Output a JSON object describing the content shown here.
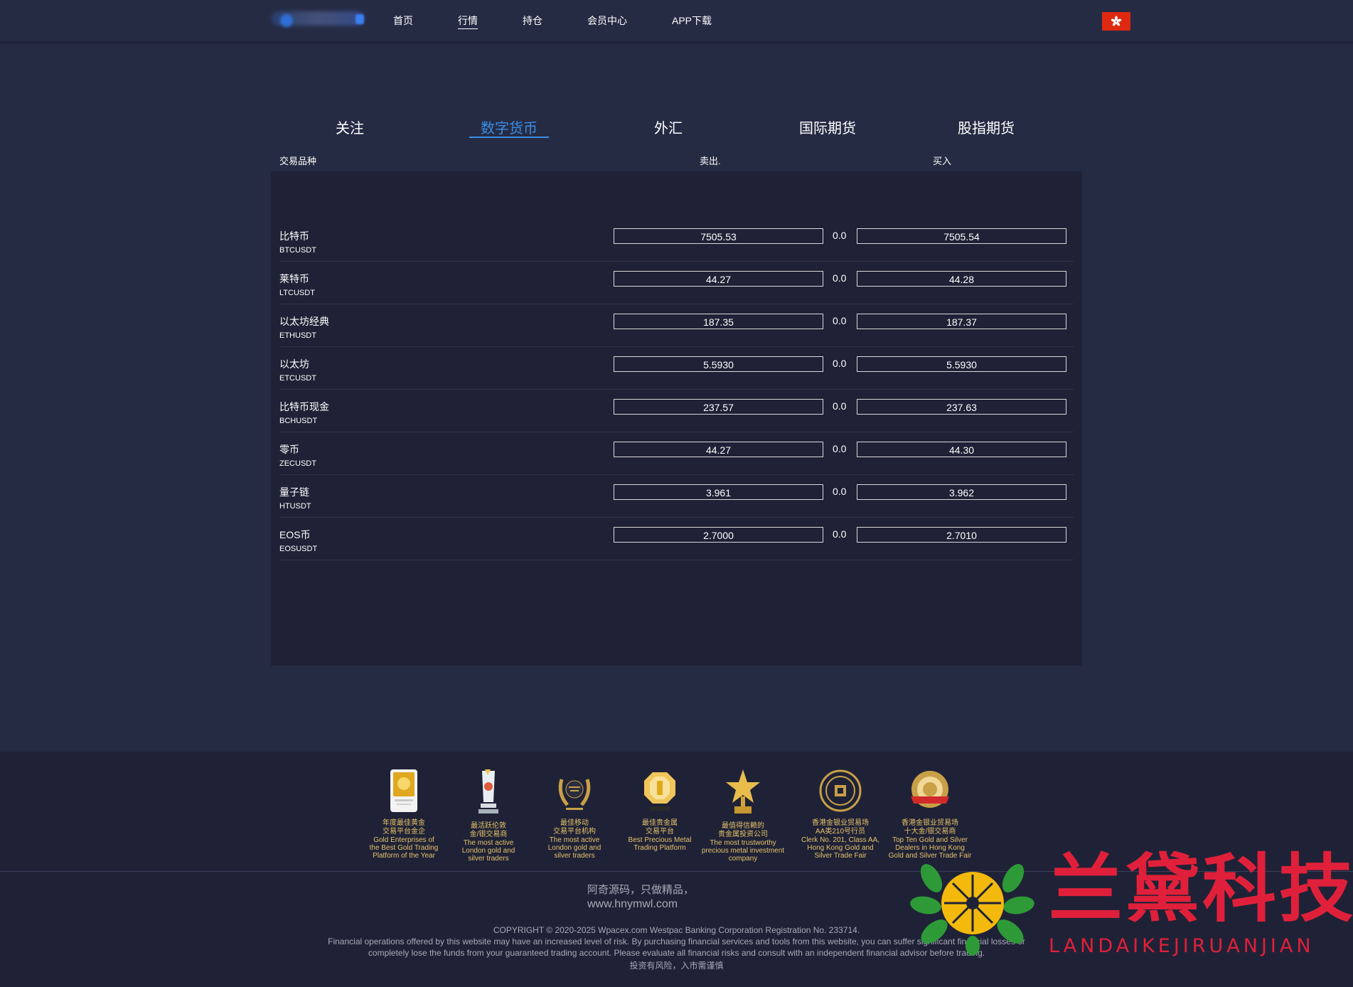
{
  "nav": {
    "items": [
      {
        "label": "首页"
      },
      {
        "label": "行情"
      },
      {
        "label": "持仓"
      },
      {
        "label": "会员中心"
      },
      {
        "label": "APP下载"
      }
    ],
    "active_index": 1,
    "language": "hong-kong-flag-icon"
  },
  "tabs": {
    "items": [
      {
        "label": "关注"
      },
      {
        "label": "数字货币"
      },
      {
        "label": "外汇"
      },
      {
        "label": "国际期货"
      },
      {
        "label": "股指期货"
      }
    ],
    "active_index": 1
  },
  "table": {
    "headers": {
      "instrument": "交易品种",
      "sell": "卖出.",
      "buy": "买入"
    },
    "rows": [
      {
        "name": "比特币",
        "code": "BTCUSDT",
        "sell": "7505.53",
        "change": "0.0",
        "buy": "7505.54"
      },
      {
        "name": "莱特币",
        "code": "LTCUSDT",
        "sell": "44.27",
        "change": "0.0",
        "buy": "44.28"
      },
      {
        "name": "以太坊经典",
        "code": "ETHUSDT",
        "sell": "187.35",
        "change": "0.0",
        "buy": "187.37"
      },
      {
        "name": "以太坊",
        "code": "ETCUSDT",
        "sell": "5.5930",
        "change": "0.0",
        "buy": "5.5930"
      },
      {
        "name": "比特币现金",
        "code": "BCHUSDT",
        "sell": "237.57",
        "change": "0.0",
        "buy": "237.63"
      },
      {
        "name": "零币",
        "code": "ZECUSDT",
        "sell": "44.27",
        "change": "0.0",
        "buy": "44.30"
      },
      {
        "name": "量子链",
        "code": "HTUSDT",
        "sell": "3.961",
        "change": "0.0",
        "buy": "3.962"
      },
      {
        "name": "EOS币",
        "code": "EOSUSDT",
        "sell": "2.7000",
        "change": "0.0",
        "buy": "2.7010"
      }
    ]
  },
  "awards": [
    {
      "cn": "年度最佳黄金\n交易平台金企",
      "en": "Gold Enterprises of\nthe Best Gold Trading\nPlatform of the Year",
      "icon": "gold-plaque-icon"
    },
    {
      "cn": "最活跃伦敦\n金/银交易商",
      "en": "The most active\nLondon gold and\nsilver traders",
      "icon": "crystal-trophy-icon"
    },
    {
      "cn": "最佳移动\n交易平台机构",
      "en": "The most active\nLondon gold and\nsilver traders",
      "icon": "laurel-wreath-icon"
    },
    {
      "cn": "最佳贵金属\n交易平台",
      "en": "Best Precious Metal\nTrading Platform",
      "icon": "gold-octagon-icon"
    },
    {
      "cn": "最值得信赖的\n贵金属投资公司",
      "en": "The most trustworthy\nprecious metal investment\ncompany",
      "icon": "gold-star-trophy-icon"
    },
    {
      "cn": "香港金银业贸易场\nAA类210号行员",
      "en": "Clerk No. 201, Class AA,\nHong Kong Gold and\nSilver Trade Fair",
      "icon": "round-seal-icon"
    },
    {
      "cn": "香港金银业贸易场\n十大金/银交易商",
      "en": "Top Ten Gold and Silver\nDealers in Hong Kong\nGold and Silver Trade Fair",
      "icon": "red-ribbon-medal-icon"
    }
  ],
  "footer": {
    "slogan": "阿奇源码，只做精品，",
    "site": "www.hnymwl.com",
    "copyright": "COPYRIGHT © 2020-2025 Wpacex.com Westpac Banking Corporation Registration No. 233714.",
    "disclaimer_1": "Financial operations offered by this website may have an increased level of risk. By purchasing financial services and tools from this website, you can suffer significant financial losses or",
    "disclaimer_2": "completely lose the funds from your guaranteed trading account. Please evaluate all financial risks and consult with an independent financial advisor before trading.",
    "warning": "投资有风险，入市需谨慎"
  },
  "watermark": {
    "cn": "兰黛科技",
    "en": "LANDAIKEJIRUANJIAN",
    "color": "#e0203a"
  },
  "colors": {
    "background": "#262b44",
    "panel": "#1f2236",
    "accent": "#3a8ee6",
    "award_gold": "#e6c26b"
  }
}
